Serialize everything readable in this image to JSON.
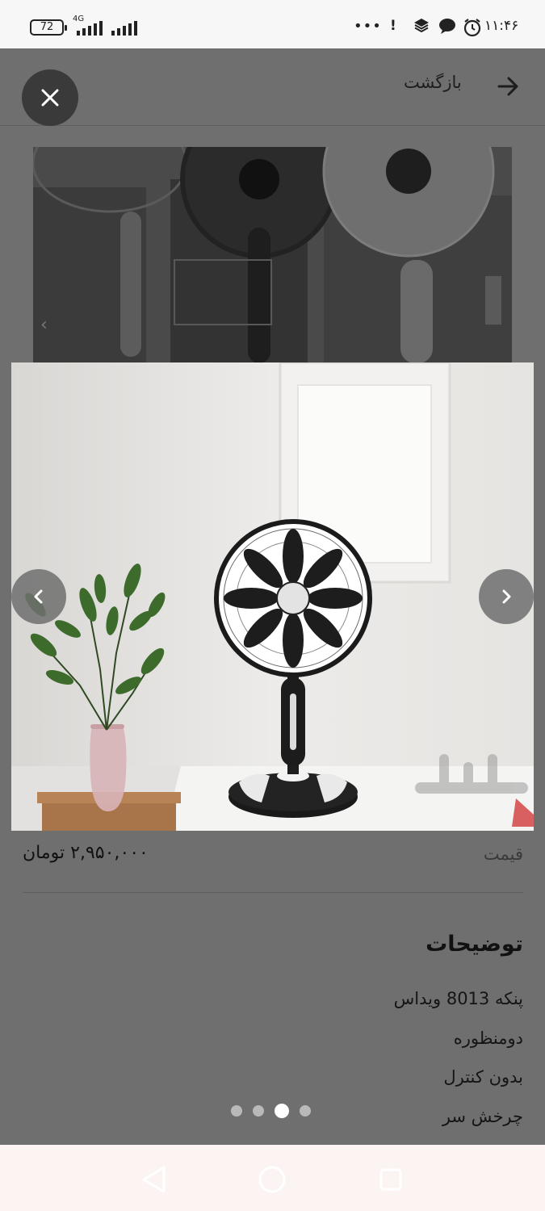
{
  "status_bar": {
    "battery": "72",
    "network": "4G",
    "time": "۱۱:۴۶",
    "dots": "•••"
  },
  "header": {
    "back_label": "بازگشت"
  },
  "gallery": {
    "total_images": 4,
    "active_index": 3
  },
  "price": {
    "label": "قیمت",
    "value": "۲,۹۵۰,۰۰۰ تومان"
  },
  "description": {
    "title": "توضیحات",
    "lines": [
      "پنکه 8013 ویداس",
      "دومنظوره",
      "بدون کنترل",
      "چرخش سر"
    ]
  },
  "colors": {
    "overlay": "#6f6f6f",
    "close_button": "#3a3a3a",
    "nav_bar": "#fbf4f2"
  }
}
